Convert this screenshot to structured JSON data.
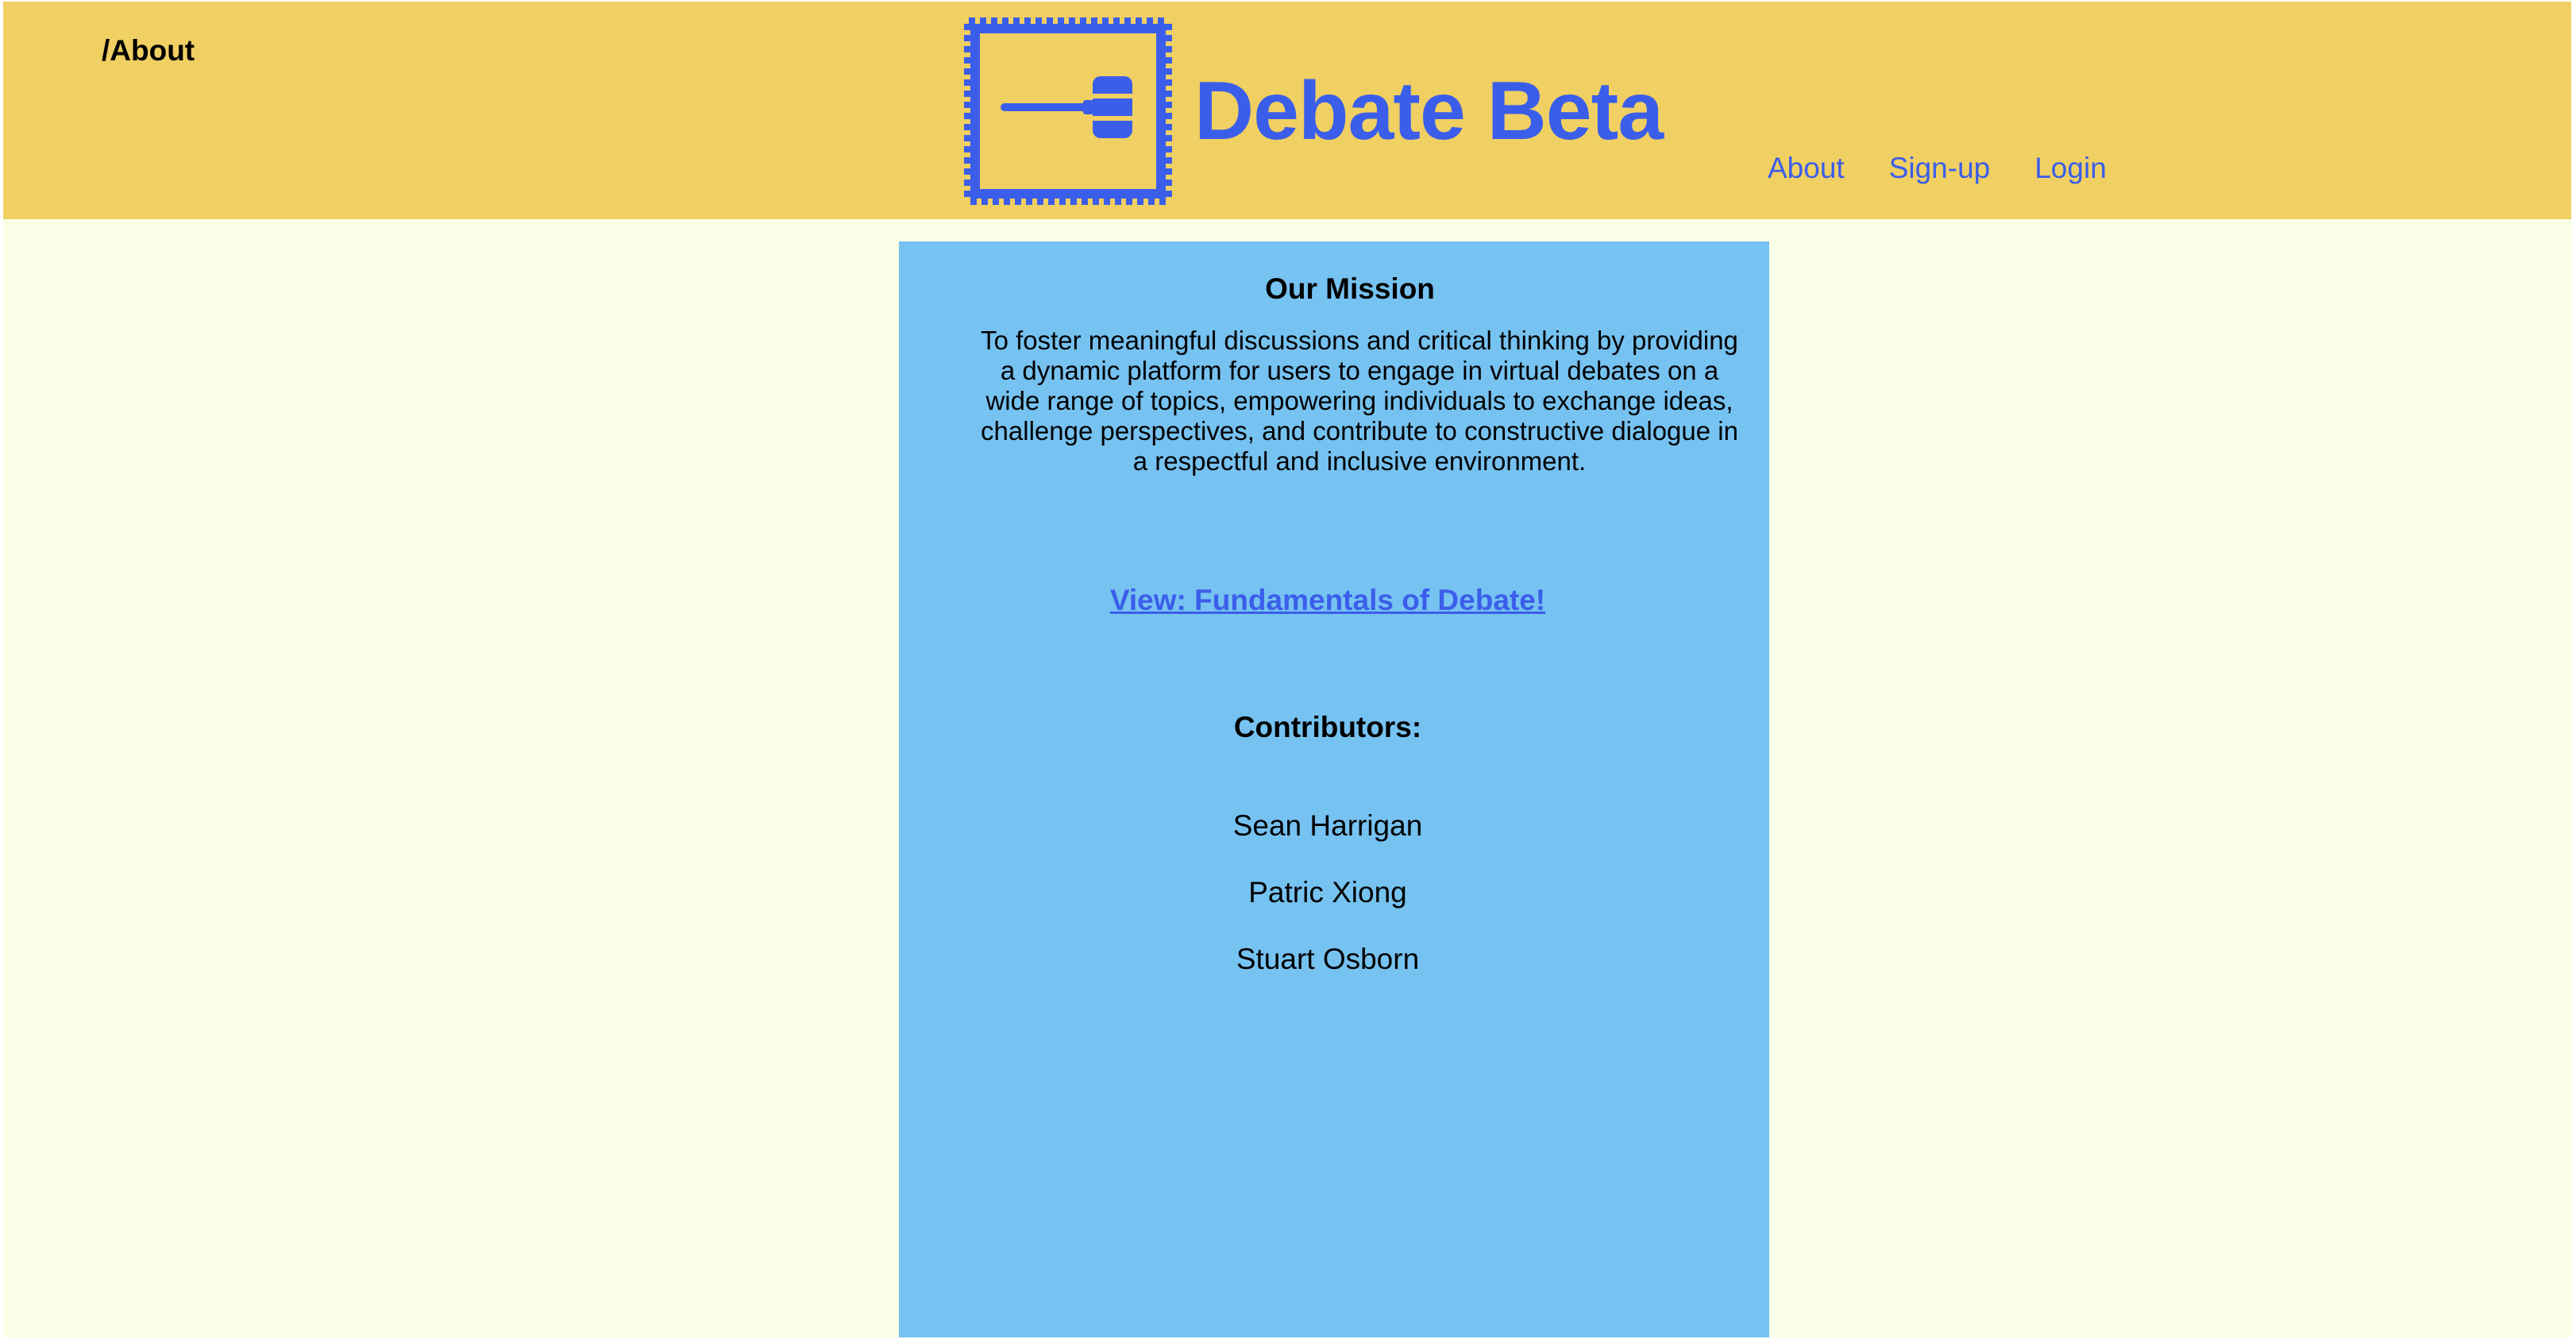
{
  "header": {
    "path": "/About",
    "brand_title": "Debate Beta",
    "logo_icon": "gavel-stamp-icon",
    "nav": [
      {
        "label": "About"
      },
      {
        "label": "Sign-up"
      },
      {
        "label": "Login"
      }
    ]
  },
  "mission": {
    "title": "Our Mission",
    "text": "To foster meaningful discussions and critical thinking by providing a dynamic platform for users to engage in virtual debates on a wide range of topics, empowering individuals to exchange ideas, challenge perspectives, and contribute to constructive dialogue in a respectful and inclusive environment."
  },
  "fundamentals_link": "View: Fundamentals of Debate!",
  "contributors": {
    "title": "Contributors:",
    "names": [
      "Sean Harrigan",
      "Patric Xiong",
      "Stuart Osborn"
    ]
  },
  "colors": {
    "header_bg": "#f0cf63",
    "page_bg": "#f9ffe6",
    "panel_bg": "#76c2f1",
    "accent": "#3b5eea"
  }
}
